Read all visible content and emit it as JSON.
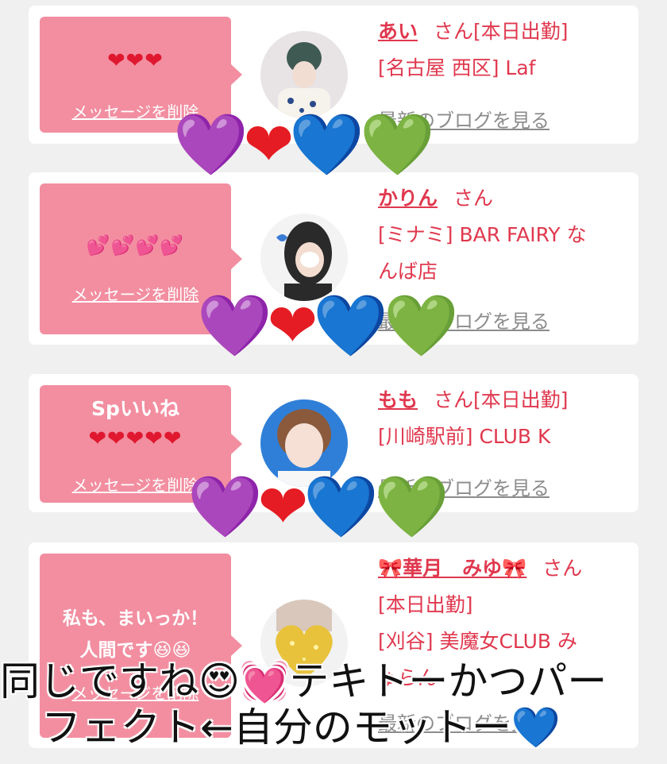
{
  "colors": {
    "bubble": "#f28ea0",
    "accent_text": "#e0384e",
    "link_gray": "#8c8c8c",
    "background": "#f0f0f0"
  },
  "cards": [
    {
      "message": "",
      "hearts": "❤❤❤",
      "delete_label": "メッセージを削除",
      "name": "あい",
      "san": "さん[本日出勤]",
      "line2": "[名古屋 西区] Laf",
      "line3": "",
      "blog_label": "最新のブログを見る",
      "avatar_icon": "avatar-photo"
    },
    {
      "message": "",
      "hearts": "💕💕💕💕",
      "delete_label": "メッセージを削除",
      "name": "かりん",
      "san": "さん",
      "line2": "[ミナミ] BAR FAIRY な",
      "line3": "んば店",
      "blog_label": "最新のブログを見る",
      "avatar_icon": "avatar-photo"
    },
    {
      "message": "Spいいね",
      "hearts": "❤❤❤❤❤",
      "delete_label": "メッセージを削除",
      "name": "もも",
      "san": "さん[本日出勤]",
      "line2": "[川崎駅前] CLUB K",
      "line3": "",
      "blog_label": "最新のブログを見る",
      "avatar_icon": "avatar-photo"
    },
    {
      "message_line1": "私も、まいっか！",
      "message_line2": "人間です😆😆",
      "delete_label": "メッセージを削除",
      "name": "🎀華月　みゆ🎀",
      "san": "さん",
      "line2": "[本日出勤]",
      "line3": "[刈谷] 美魔女CLUB み",
      "line4": "ゅらん",
      "blog_label": "最新のブログを見る",
      "avatar_icon": "avatar-gold-heart"
    }
  ],
  "overlay": {
    "hearts": [
      "💜",
      "❤",
      "💙",
      "💚"
    ]
  },
  "caption": {
    "line1": "同じですね😍💓テキトーかつパー",
    "line2": "フェクト←自分のモットー💙"
  }
}
